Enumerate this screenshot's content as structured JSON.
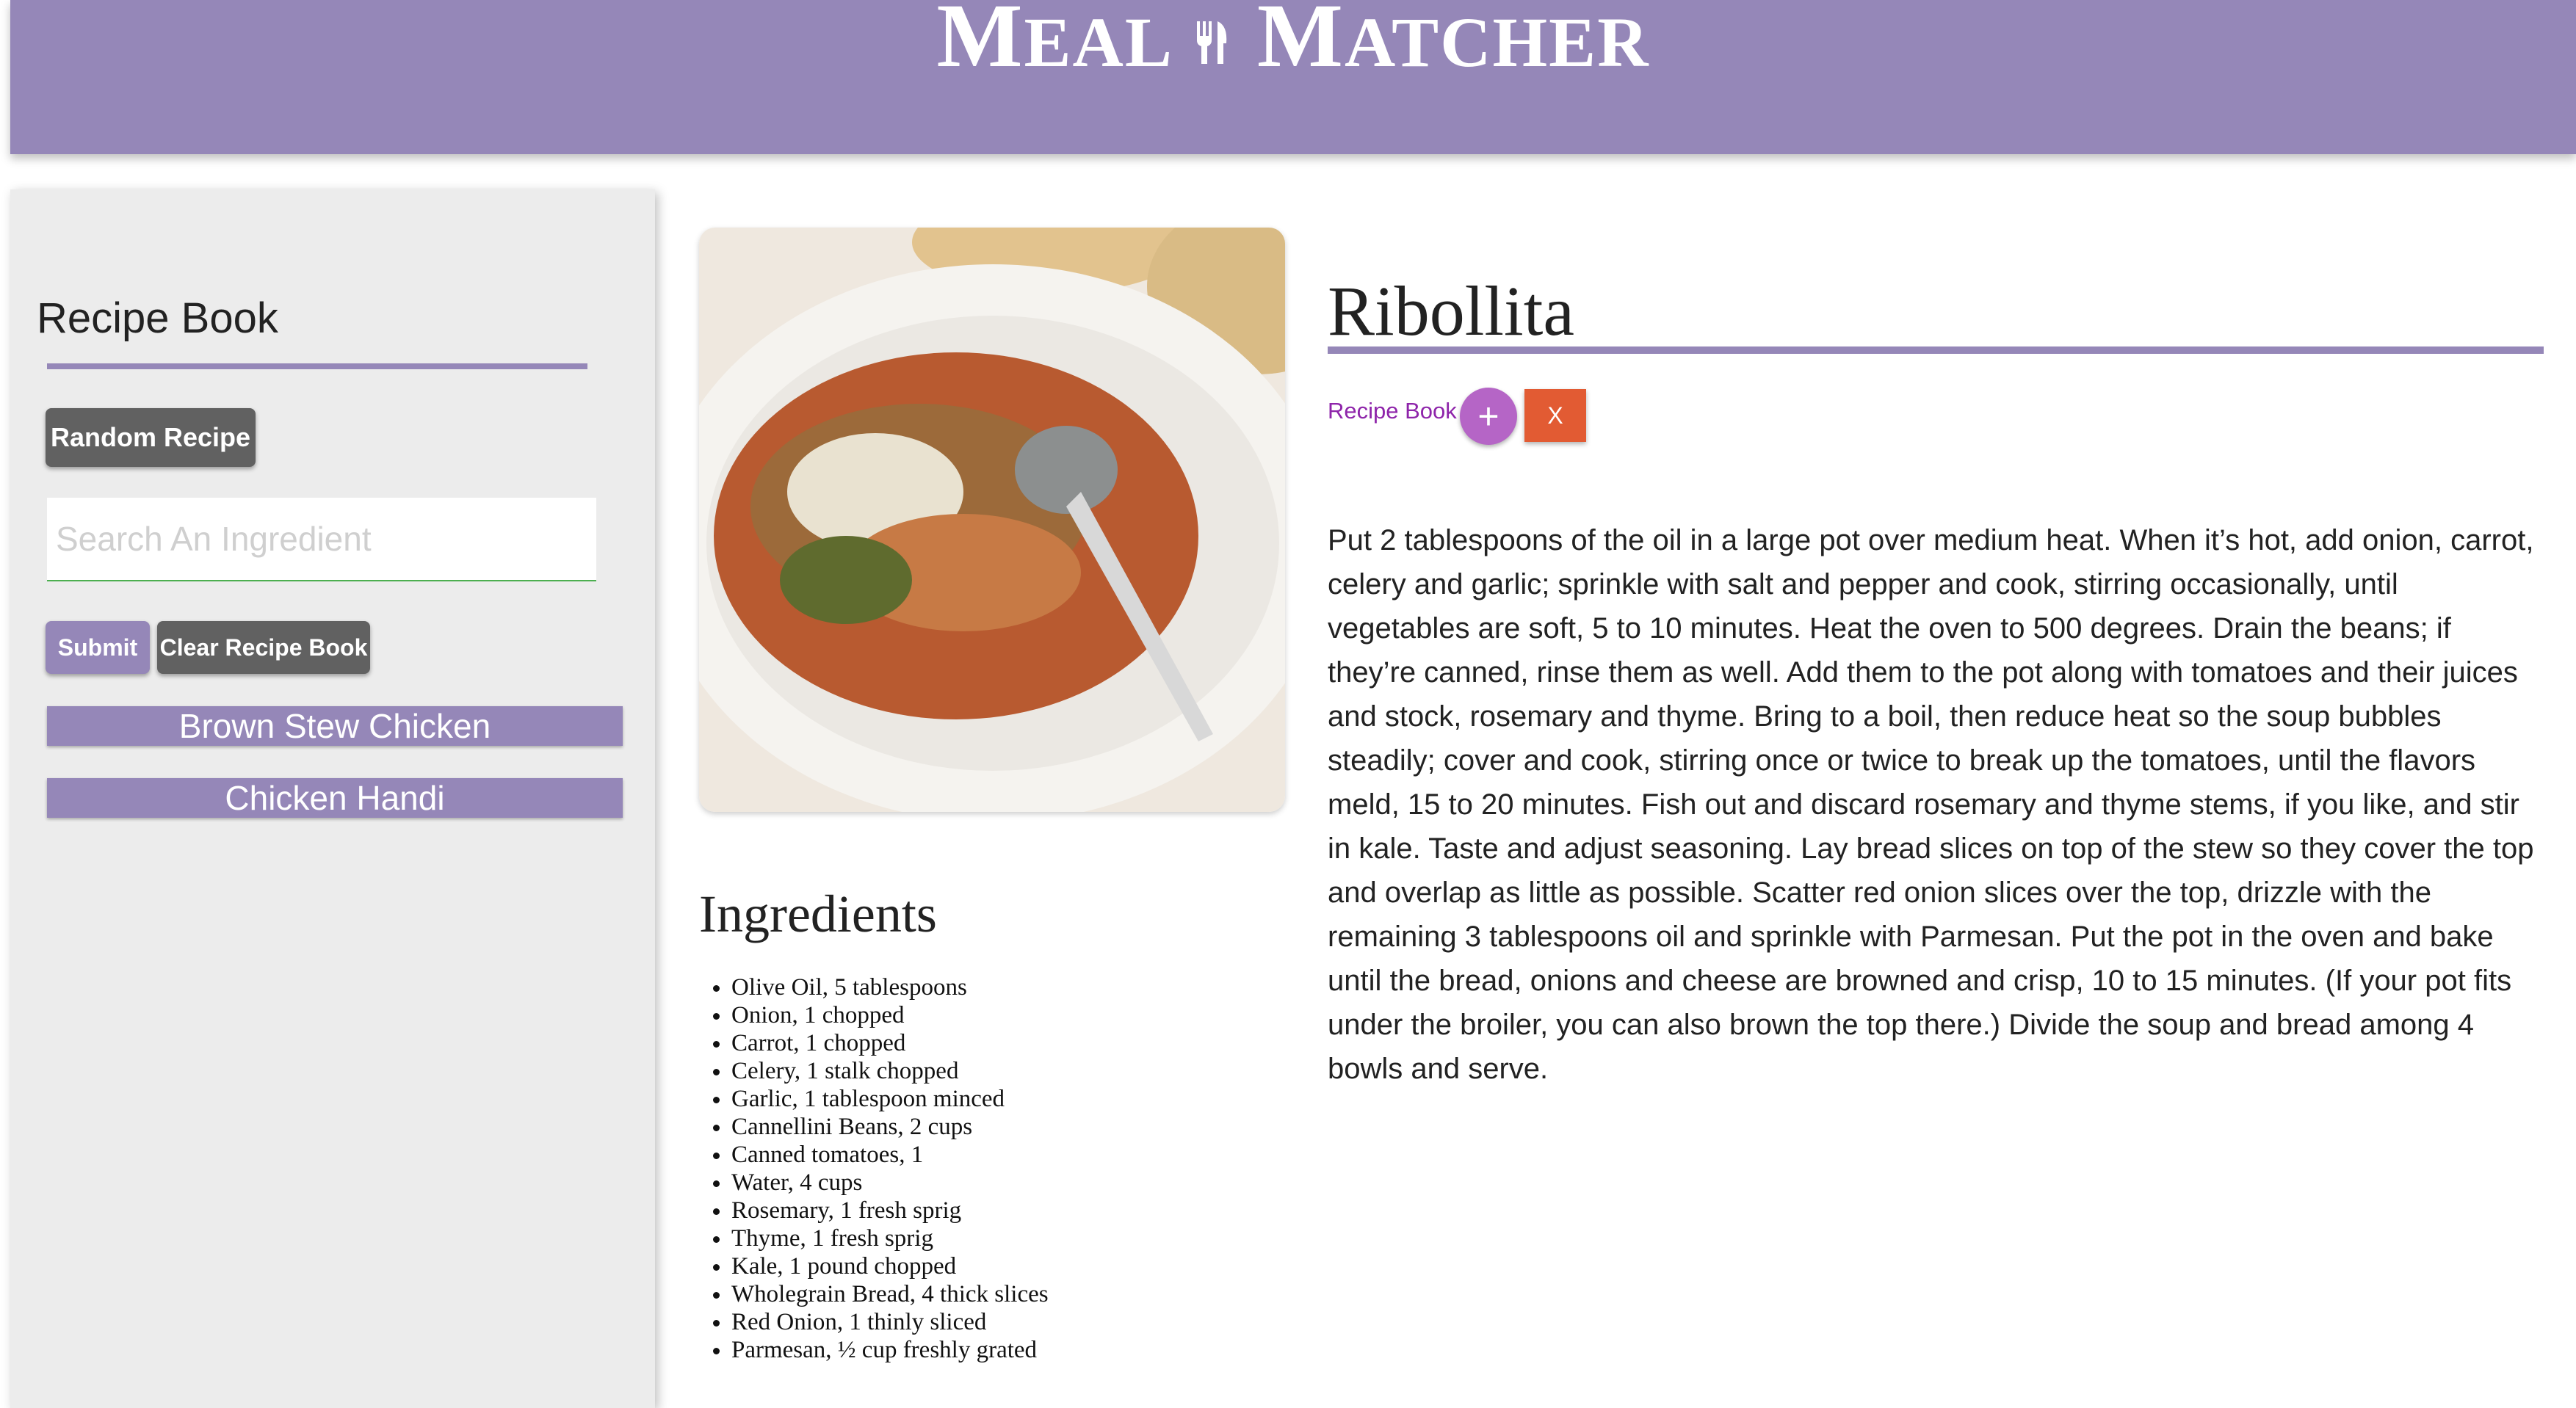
{
  "header": {
    "brand_part1_first": "M",
    "brand_part1_rest": "EAL",
    "brand_part2_first": "M",
    "brand_part2_rest": "ATCHER",
    "brand_icon": "fork-knife-icon",
    "color": "#9587b8"
  },
  "sidebar": {
    "title": "Recipe Book",
    "random_button": "Random Recipe",
    "search_placeholder": "Search An Ingredient",
    "submit_button": "Submit",
    "clear_button": "Clear Recipe Book",
    "saved_recipes": [
      "Brown Stew Chicken",
      "Chicken Handi"
    ]
  },
  "recipe": {
    "title": "Ribollita",
    "recipe_book_label": "Recipe Book",
    "add_button": "+",
    "remove_button": "X",
    "ingredients_title": "Ingredients",
    "ingredients": [
      "Olive Oil, 5 tablespoons",
      "Onion, 1 chopped",
      "Carrot, 1 chopped",
      "Celery, 1 stalk chopped",
      "Garlic, 1 tablespoon minced",
      "Cannellini Beans, 2 cups",
      "Canned tomatoes, 1",
      "Water, 4 cups",
      "Rosemary, 1 fresh sprig",
      "Thyme, 1 fresh sprig",
      "Kale, 1 pound chopped",
      "Wholegrain Bread, 4 thick slices",
      "Red Onion, 1 thinly sliced",
      "Parmesan, ½ cup freshly grated"
    ],
    "instructions": "Put 2 tablespoons of the oil in a large pot over medium heat. When it’s hot, add onion, carrot, celery and garlic; sprinkle with salt and pepper and cook, stirring occasionally, until vegetables are soft, 5 to 10 minutes. Heat the oven to 500 degrees. Drain the beans; if they’re canned, rinse them as well. Add them to the pot along with tomatoes and their juices and stock, rosemary and thyme. Bring to a boil, then reduce heat so the soup bubbles steadily; cover and cook, stirring once or twice to break up the tomatoes, until the flavors meld, 15 to 20 minutes. Fish out and discard rosemary and thyme stems, if you like, and stir in kale. Taste and adjust seasoning. Lay bread slices on top of the stew so they cover the top and overlap as little as possible. Scatter red onion slices over the top, drizzle with the remaining 3 tablespoons oil and sprinkle with Parmesan. Put the pot in the oven and bake until the bread, onions and cheese are browned and crisp, 10 to 15 minutes. (If your pot fits under the broiler, you can also brown the top there.) Divide the soup and bread among 4 bowls and serve."
  }
}
